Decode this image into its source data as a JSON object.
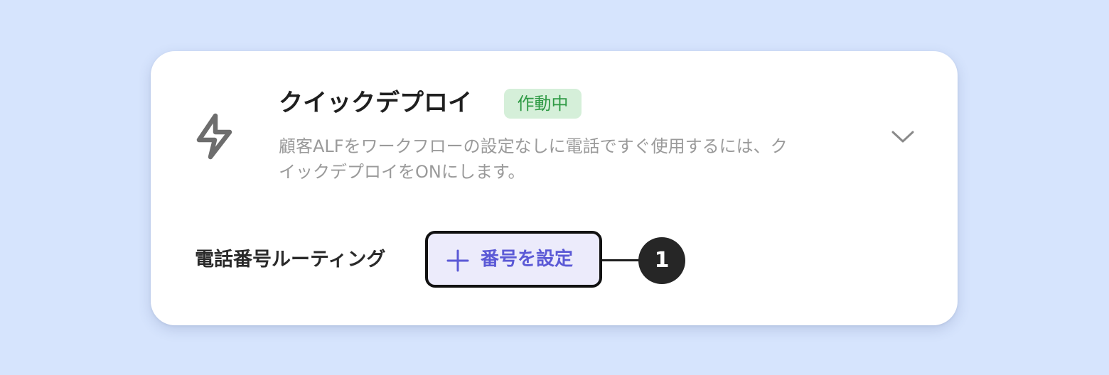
{
  "card": {
    "icon": "lightning-bolt-icon",
    "title": "クイックデプロイ",
    "status_badge": "作動中",
    "description_line1": "顧客ALFをワークフローの設定なしに電話ですぐ使用するには、ク",
    "description_line2": "イックデプロイをONにします。",
    "expand_icon": "chevron-down-icon"
  },
  "routing": {
    "label": "電話番号ルーティング",
    "button_icon": "plus-icon",
    "button_label": "番号を設定"
  },
  "annotation": {
    "callout_number": "1"
  },
  "colors": {
    "background": "#d6e4fd",
    "badge_bg": "#d5efd9",
    "badge_text": "#2f9a45",
    "button_bg": "#ecebfb",
    "button_text": "#5b59d6",
    "callout_bg": "#262626"
  }
}
